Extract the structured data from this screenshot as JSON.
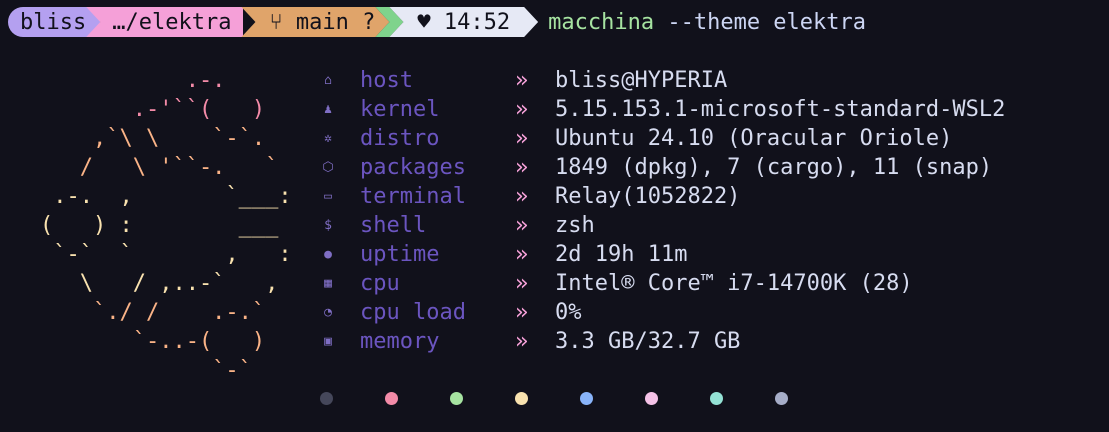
{
  "prompt": {
    "user": "bliss",
    "path": "…/elektra",
    "git_icon": "git-branch-icon",
    "git": "main ?",
    "time_icon": "shield-icon",
    "time": "14:52",
    "command_program": "macchina",
    "command_args": "--theme elektra",
    "colors": {
      "user": "#b4a0f0",
      "path": "#f5a0d8",
      "git": "#e0a46a",
      "green": "#7fd38c",
      "time": "#e6e9f5",
      "program": "#a6e3a1"
    }
  },
  "ascii_art": {
    "lines": [
      {
        "segments": [
          {
            "text": "           .-.",
            "color": "#f38ba8"
          }
        ]
      },
      {
        "segments": [
          {
            "text": "       .-'``(   )",
            "color": "#f38ba8"
          }
        ]
      },
      {
        "segments": [
          {
            "text": "    ,`\\ \\    `-`.",
            "color": "#fab387"
          }
        ]
      },
      {
        "segments": [
          {
            "text": "   /   \\ '``-.   `",
            "color": "#fab387"
          }
        ]
      },
      {
        "segments": [
          {
            "text": " .-.  ,       `___:",
            "color": "#f9e2af"
          }
        ]
      },
      {
        "segments": [
          {
            "text": "(   ) :        ___",
            "color": "#f9e2af"
          }
        ]
      },
      {
        "segments": [
          {
            "text": " `-`  `       ,   :",
            "color": "#f9e2af"
          }
        ]
      },
      {
        "segments": [
          {
            "text": "   \\   / ,..-`   ,",
            "color": "#f9e2af"
          }
        ]
      },
      {
        "segments": [
          {
            "text": "    `./ /    .-.`",
            "color": "#fab387"
          }
        ]
      },
      {
        "segments": [
          {
            "text": "       `-..-(   )",
            "color": "#fab387"
          }
        ]
      },
      {
        "segments": [
          {
            "text": "             `-`",
            "color": "#fab387"
          }
        ]
      }
    ]
  },
  "info": [
    {
      "icon": "home-icon",
      "glyph": "⌂",
      "key": "host",
      "sep": "»",
      "value": "bliss@HYPERIA"
    },
    {
      "icon": "penguin-icon",
      "glyph": "♟",
      "key": "kernel",
      "sep": "»",
      "value": "5.15.153.1-microsoft-standard-WSL2"
    },
    {
      "icon": "gear-icon",
      "glyph": "✲",
      "key": "distro",
      "sep": "»",
      "value": "Ubuntu 24.10 (Oracular Oriole)"
    },
    {
      "icon": "cube-icon",
      "glyph": "⬡",
      "key": "packages",
      "sep": "»",
      "value": "1849 (dpkg), 7 (cargo), 11 (snap)"
    },
    {
      "icon": "terminal-icon",
      "glyph": "▭",
      "key": "terminal",
      "sep": "»",
      "value": "Relay(1052822)"
    },
    {
      "icon": "dollar-icon",
      "glyph": "$",
      "key": "shell",
      "sep": "»",
      "value": "zsh"
    },
    {
      "icon": "clock-icon",
      "glyph": "●",
      "key": "uptime",
      "sep": "»",
      "value": "2d 19h 11m"
    },
    {
      "icon": "chip-icon",
      "glyph": "▦",
      "key": "cpu",
      "sep": "»",
      "value": "Intel® Core™ i7-14700K (28)"
    },
    {
      "icon": "gauge-icon",
      "glyph": "◔",
      "key": "cpu load",
      "sep": "»",
      "value": "0%"
    },
    {
      "icon": "memory-icon",
      "glyph": "▣",
      "key": "memory",
      "sep": "»",
      "value": "3.3 GB/32.7 GB"
    }
  ],
  "palette": [
    "#45475a",
    "#f38ba8",
    "#a6e3a1",
    "#f9e2af",
    "#89b4fa",
    "#f5c2e7",
    "#94e2d5",
    "#a6adc8"
  ]
}
